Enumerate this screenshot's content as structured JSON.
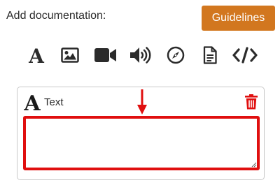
{
  "header": {
    "label": "Add documentation:",
    "guidelines_button": "Guidelines",
    "button_color": "#d2771f"
  },
  "toolbar": {
    "tools": [
      {
        "name": "text",
        "icon": "text-icon"
      },
      {
        "name": "image",
        "icon": "image-icon"
      },
      {
        "name": "video",
        "icon": "video-camera-icon"
      },
      {
        "name": "audio",
        "icon": "volume-icon"
      },
      {
        "name": "explore",
        "icon": "compass-icon"
      },
      {
        "name": "document",
        "icon": "document-icon"
      },
      {
        "name": "code",
        "icon": "code-icon"
      }
    ]
  },
  "card": {
    "title": "Text",
    "title_icon": "text-icon",
    "delete_icon": "trash-icon",
    "delete_color": "#e00f0f",
    "textarea_value": "",
    "highlight_color": "#e00f0f",
    "arrow_icon": "arrow-down-icon"
  }
}
